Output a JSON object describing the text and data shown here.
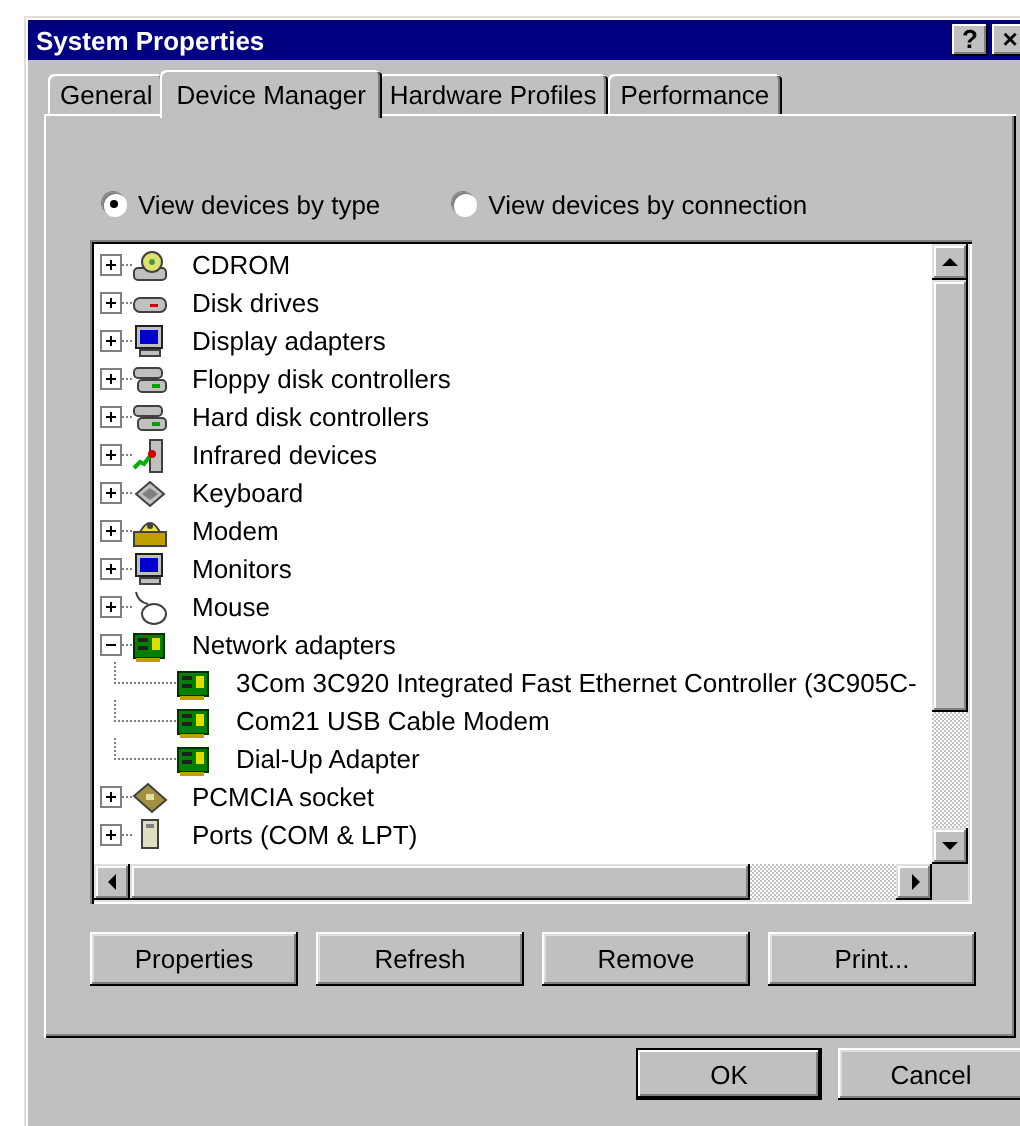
{
  "window": {
    "title": "System Properties",
    "help_button": "?",
    "close_button": "×"
  },
  "tabs": [
    {
      "label": "General",
      "selected": false
    },
    {
      "label": "Device Manager",
      "selected": true
    },
    {
      "label": "Hardware Profiles",
      "selected": false
    },
    {
      "label": "Performance",
      "selected": false
    }
  ],
  "view_options": [
    {
      "label": "View devices by type",
      "selected": true
    },
    {
      "label": "View devices by connection",
      "selected": false
    }
  ],
  "devices": [
    {
      "label": "CDROM",
      "kind": "cdrom",
      "expanded": false
    },
    {
      "label": "Disk drives",
      "kind": "disk",
      "expanded": false
    },
    {
      "label": "Display adapters",
      "kind": "monitor",
      "expanded": false
    },
    {
      "label": "Floppy disk controllers",
      "kind": "controller",
      "expanded": false
    },
    {
      "label": "Hard disk controllers",
      "kind": "controller",
      "expanded": false
    },
    {
      "label": "Infrared devices",
      "kind": "infrared",
      "expanded": false
    },
    {
      "label": "Keyboard",
      "kind": "keyboard",
      "expanded": false
    },
    {
      "label": "Modem",
      "kind": "modem",
      "expanded": false
    },
    {
      "label": "Monitors",
      "kind": "monitor",
      "expanded": false
    },
    {
      "label": "Mouse",
      "kind": "mouse",
      "expanded": false
    },
    {
      "label": "Network adapters",
      "kind": "network",
      "expanded": true,
      "children": [
        {
          "label": "3Com 3C920 Integrated Fast Ethernet Controller (3C905C-",
          "kind": "network"
        },
        {
          "label": "Com21 USB Cable Modem",
          "kind": "network"
        },
        {
          "label": "Dial-Up Adapter",
          "kind": "network"
        }
      ]
    },
    {
      "label": "PCMCIA socket",
      "kind": "pcmcia",
      "expanded": false
    },
    {
      "label": "Ports (COM & LPT)",
      "kind": "port",
      "expanded": false
    }
  ],
  "device_buttons": [
    "Properties",
    "Refresh",
    "Remove",
    "Print..."
  ],
  "dialog_buttons": [
    {
      "label": "OK",
      "default": true
    },
    {
      "label": "Cancel",
      "default": false
    }
  ]
}
